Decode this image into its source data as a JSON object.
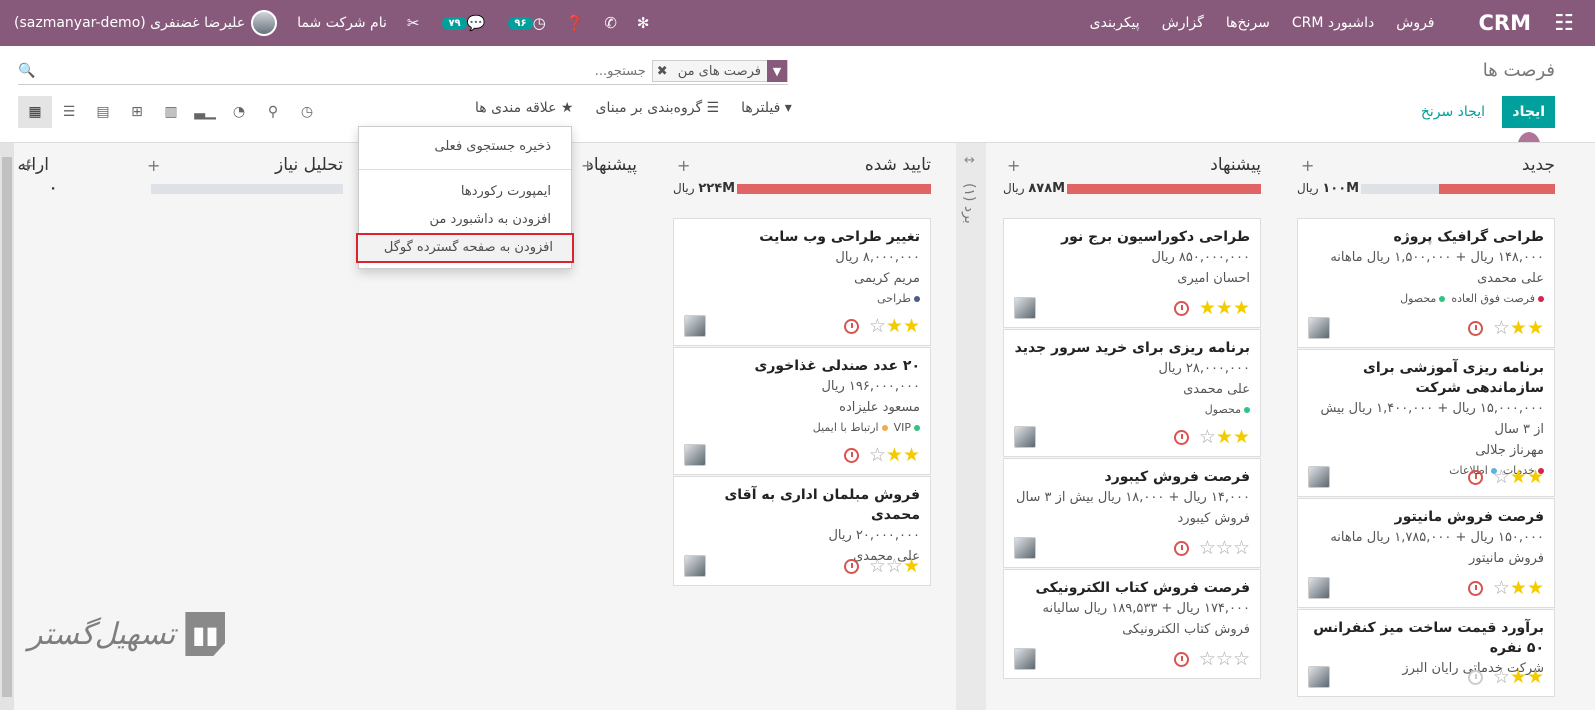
{
  "navbar": {
    "brand": "CRM",
    "menu": [
      "فروش",
      "داشبورد CRM",
      "سرنخ‌ها",
      "گزارش",
      "پیکربندی"
    ],
    "user": "علیرضا غضنفری (sazmanyar-demo)",
    "company": "نام شرکت شما",
    "messages_badge": "۷۹",
    "activities_badge": "۹۶"
  },
  "control": {
    "breadcrumb": "فرصت ها",
    "facet": "فرصت های من",
    "search_placeholder": "جستجو...",
    "create": "ایجاد",
    "create_lead": "ایجاد سرنخ",
    "filters": "فیلترها",
    "group_by": "گروه‌بندی بر مبنای",
    "favorites": "علاقه مندی ها"
  },
  "dropdown": {
    "save_search": "ذخیره جستجوی فعلی",
    "import": "ایمپورت رکوردها",
    "add_dashboard": "افزودن به داشبورد من",
    "add_gsheet": "افزودن به صفحه گسترده گوگل"
  },
  "folded_column": "برد (۱)",
  "columns": [
    {
      "title": "جدید",
      "amount": "۱۰۰M",
      "currency": "ریال",
      "progress": 0.6,
      "cards": [
        {
          "title": "طراحی گرافیک پروژه",
          "line1": "۱۴۸,۰۰۰ ریال + ۱,۵۰۰,۰۰۰ ریال ماهانه",
          "line2": "علی محمدی",
          "tags": [
            {
              "name": "فرصت فوق العاده",
              "color": "#d9234a"
            },
            {
              "name": "محصول",
              "color": "#30c381"
            }
          ],
          "stars": 2,
          "activity": "red"
        },
        {
          "title": "برنامه ریزی آموزشی برای سازماندهی شرکت",
          "line1": "۱۵,۰۰۰,۰۰۰ ریال + ۱,۴۰۰,۰۰۰ ریال بیش از ۳ سال",
          "line2": "مهرناز جلالی",
          "tags": [
            {
              "name": "خدمات",
              "color": "#d9234a"
            },
            {
              "name": "اطلاعات",
              "color": "#5bb3e0"
            }
          ],
          "stars": 2,
          "activity": "red"
        },
        {
          "title": "فرصت فروش مانیتور",
          "line1": "۱۵۰,۰۰۰ ریال + ۱,۷۸۵,۰۰۰ ریال ماهانه",
          "line2": "فروش مانیتور",
          "tags": [],
          "stars": 2,
          "activity": "red"
        },
        {
          "title": "برآورد قیمت ساخت میز کنفرانس ۵۰ نفره",
          "line1": "شرکت خدماتی رایان البرز",
          "line2": "",
          "tags": [],
          "stars": 2,
          "activity": "grey"
        }
      ]
    },
    {
      "title": "پیشنهاد",
      "amount": "۸۷۸M",
      "currency": "ریال",
      "progress": 1,
      "cards": [
        {
          "title": "طراحی دکوراسیون برج نور",
          "line1": "۸۵۰,۰۰۰,۰۰۰ ریال",
          "line2": "احسان امیری",
          "tags": [],
          "stars": 3,
          "activity": "red"
        },
        {
          "title": "برنامه ریزی برای خرید سرور جدید",
          "line1": "۲۸,۰۰۰,۰۰۰ ریال",
          "line2": "علی محمدی",
          "tags": [
            {
              "name": "محصول",
              "color": "#30c381"
            }
          ],
          "stars": 2,
          "activity": "red"
        },
        {
          "title": "فرصت فروش کیبورد",
          "line1": "۱۴,۰۰۰ ریال + ۱۸,۰۰۰ ریال بیش از ۳ سال",
          "line2": "فروش کیبورد",
          "tags": [],
          "stars": 0,
          "activity": "red"
        },
        {
          "title": "فرصت فروش کتاب الکترونیکی",
          "line1": "۱۷۴,۰۰۰ ریال + ۱۸۹,۵۳۳ ریال سالیانه",
          "line2": "فروش کتاب الکترونیکی",
          "tags": [],
          "stars": 0,
          "activity": "red"
        }
      ]
    },
    {
      "title": "تایید شده",
      "amount": "۲۲۴M",
      "currency": "ریال",
      "progress": 1,
      "cards": [
        {
          "title": "تغییر طراحی وب سایت",
          "line1": "۸,۰۰۰,۰۰۰ ریال",
          "line2": "مریم کریمی",
          "tags": [
            {
              "name": "طراحی",
              "color": "#4c5a8c"
            }
          ],
          "stars": 2,
          "activity": "red"
        },
        {
          "title": "۲۰ عدد صندلی غذاخوری",
          "line1": "۱۹۶,۰۰۰,۰۰۰ ریال",
          "line2": "مسعود علیزاده",
          "tags": [
            {
              "name": "VIP",
              "color": "#30c381"
            },
            {
              "name": "ارتباط با ایمیل",
              "color": "#f0ad4e"
            }
          ],
          "stars": 2,
          "activity": "red"
        },
        {
          "title": "فروش مبلمان اداری به آقای محمدی",
          "line1": "۲۰,۰۰۰,۰۰۰ ریال",
          "line2": "علی محمدی",
          "tags": [],
          "stars": 1,
          "activity": "red"
        }
      ]
    },
    {
      "title": "پیشنهاد",
      "amount": "",
      "currency": "",
      "progress": 1,
      "cards": []
    },
    {
      "title": "تحلیل نیاز",
      "amount": "",
      "currency": "",
      "progress": 0,
      "cards": []
    },
    {
      "title": "ارائه",
      "amount": "۰",
      "currency": "",
      "progress": 0,
      "cards": []
    }
  ],
  "watermark": "تسهیل‌گستر"
}
